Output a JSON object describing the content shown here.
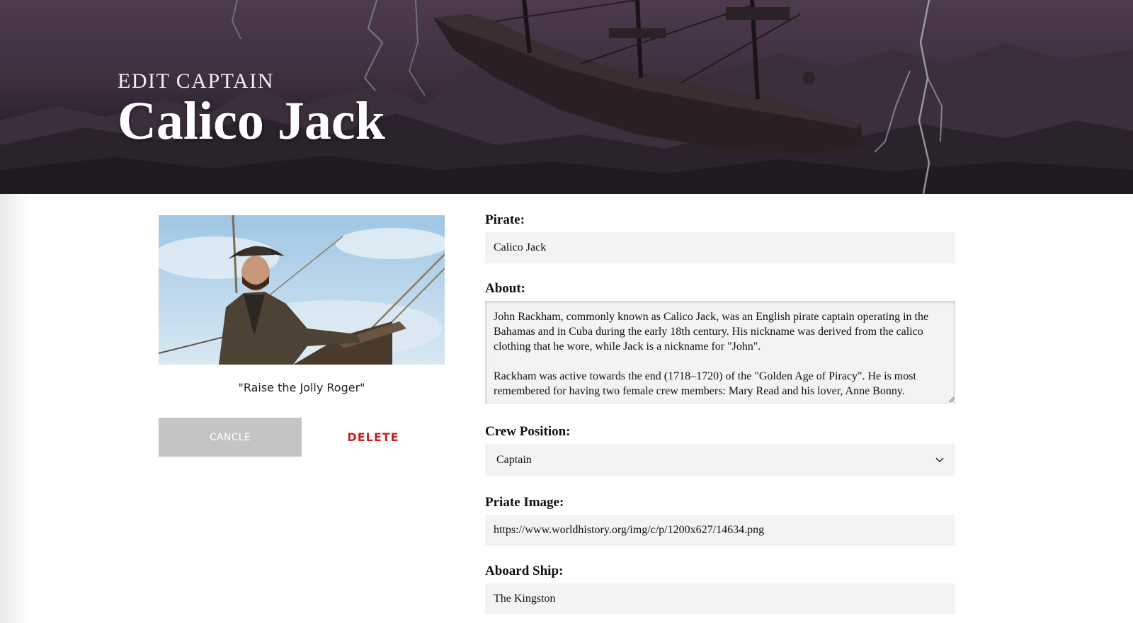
{
  "header": {
    "kicker": "EDIT CAPTAIN",
    "title": "Calico Jack"
  },
  "pirate_card": {
    "image_alt": "Calico Jack at the ship's rail",
    "motto": "\"Raise the Jolly Roger\"",
    "cancel_label": "CANCLE",
    "delete_label": "DELETE"
  },
  "form": {
    "pirate": {
      "label": "Pirate:",
      "value": "Calico Jack"
    },
    "about": {
      "label": "About:",
      "paragraphs": [
        "John Rackham, commonly known as Calico Jack, was an English pirate captain operating in the Bahamas and in Cuba during the early 18th century. His nickname was derived from the calico clothing that he wore, while Jack is a nickname for \"John\".",
        "Rackham was active towards the end (1718–1720) of the \"Golden Age of Piracy\". He is most remembered for having two female crew members: Mary Read and his lover, Anne Bonny."
      ]
    },
    "crew_position": {
      "label": "Crew Position:",
      "value": "Captain"
    },
    "image": {
      "label": "Priate Image:",
      "value": "https://www.worldhistory.org/img/c/p/1200x627/14634.png"
    },
    "ship": {
      "label": "Aboard Ship:",
      "value": "The Kingston"
    }
  },
  "colors": {
    "hero_top": "#4d3a4d",
    "hero_bottom": "#1d1820",
    "delete": "#c42222",
    "cancel_bg": "#c4c4c4",
    "field_bg": "#f3f3f3"
  }
}
